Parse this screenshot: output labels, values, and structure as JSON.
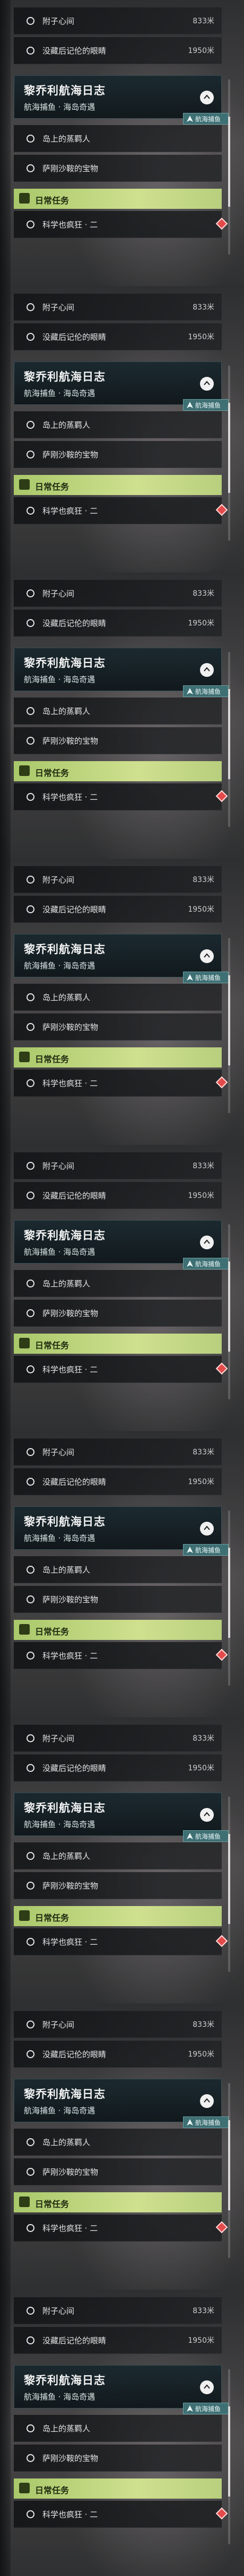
{
  "frames": [
    {
      "id": 0
    },
    {
      "id": 1
    },
    {
      "id": 2
    },
    {
      "id": 3
    },
    {
      "id": 4
    },
    {
      "id": 5
    },
    {
      "id": 6
    },
    {
      "id": 7
    },
    {
      "id": 8
    }
  ],
  "quest": {
    "row1_label": "附子心间",
    "row1_distance": "833米",
    "row2_label": "没藏后记伦的眼睛",
    "row2_distance": "1950米",
    "header_title": "黎乔利航海日志",
    "header_subtitle": "航海捕鱼 · 海岛奇遇",
    "nav_tag": "航海捕鱼",
    "sub1_label": "岛上的蒸羁人",
    "sub2_label": "萨刚沙鞍的宝物",
    "daily_label": "日常任务",
    "daily_row_label": "科学也疯狂 · 二"
  },
  "colors": {
    "daily_bar": "#bcd47a",
    "marker": "#e44a4a",
    "header_bg": "#19282e"
  },
  "icons": [
    "circle-icon",
    "chevron-up-icon",
    "navigation-icon",
    "daily-task-icon",
    "marker-diamond-icon"
  ]
}
